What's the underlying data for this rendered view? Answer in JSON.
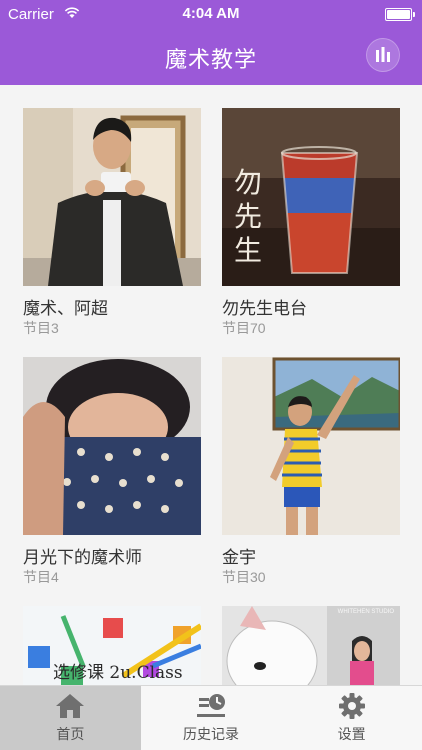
{
  "status_bar": {
    "carrier": "Carrier",
    "time": "4:04 AM"
  },
  "header": {
    "title": "魔术教学",
    "stats_icon": "bar-chart-icon",
    "bg_color": "#9b59d8"
  },
  "programs": [
    {
      "name": "魔术、阿超",
      "count": "节目3"
    },
    {
      "name": "勿先生电台",
      "count": "节目70",
      "cover_text": "勿先生"
    },
    {
      "name": "月光下的魔术师",
      "count": "节目4"
    },
    {
      "name": "金宇",
      "count": "节目30"
    },
    {
      "name": "",
      "count": "",
      "cover_text": "选修课 2u.Class"
    },
    {
      "name": "",
      "count": "",
      "cover_text": "WHITEHEN STUDIO"
    }
  ],
  "tabbar": {
    "tabs": [
      {
        "label": "首页",
        "icon": "home-icon",
        "active": true
      },
      {
        "label": "历史记录",
        "icon": "history-icon",
        "active": false
      },
      {
        "label": "设置",
        "icon": "gear-icon",
        "active": false
      }
    ]
  }
}
